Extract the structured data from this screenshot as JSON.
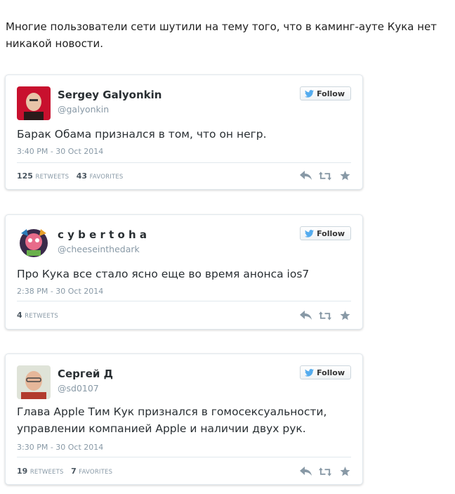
{
  "intro_text": "Многие пользователи сети шутили на тему того, что в каминг-ауте Кука нет никакой новости.",
  "follow_label": "Follow",
  "tweets": [
    {
      "name": "Sergey Galyonkin",
      "handle": "@galyonkin",
      "text": "Барак Обама признался в том, что он негр.",
      "date": "3:40 PM - 30 Oct 2014",
      "retweets": "125",
      "retweets_label": "RETWEETS",
      "favorites": "43",
      "favorites_label": "FAVORITES"
    },
    {
      "name": "c y b e r t o h a",
      "handle": "@cheeseinthedark",
      "text": "Про Кука все стало ясно еще во время анонса ios7",
      "date": "2:38 PM - 30 Oct 2014",
      "retweets": "4",
      "retweets_label": "RETWEETS"
    },
    {
      "name": "Сергей Д",
      "handle": "@sd0107",
      "text": "Глава Apple Тим Кук признался в гомосексуальности, управлении компанией Apple и наличии двух рук.",
      "date": "3:30 PM - 30 Oct 2014",
      "retweets": "19",
      "retweets_label": "RETWEETS",
      "favorites": "7",
      "favorites_label": "FAVORITES"
    }
  ],
  "colors": {
    "twitter_blue": "#55acee",
    "icon_gray": "#8899a6"
  },
  "icons": [
    "twitter-bird-icon",
    "reply-icon",
    "retweet-icon",
    "favorite-icon"
  ]
}
